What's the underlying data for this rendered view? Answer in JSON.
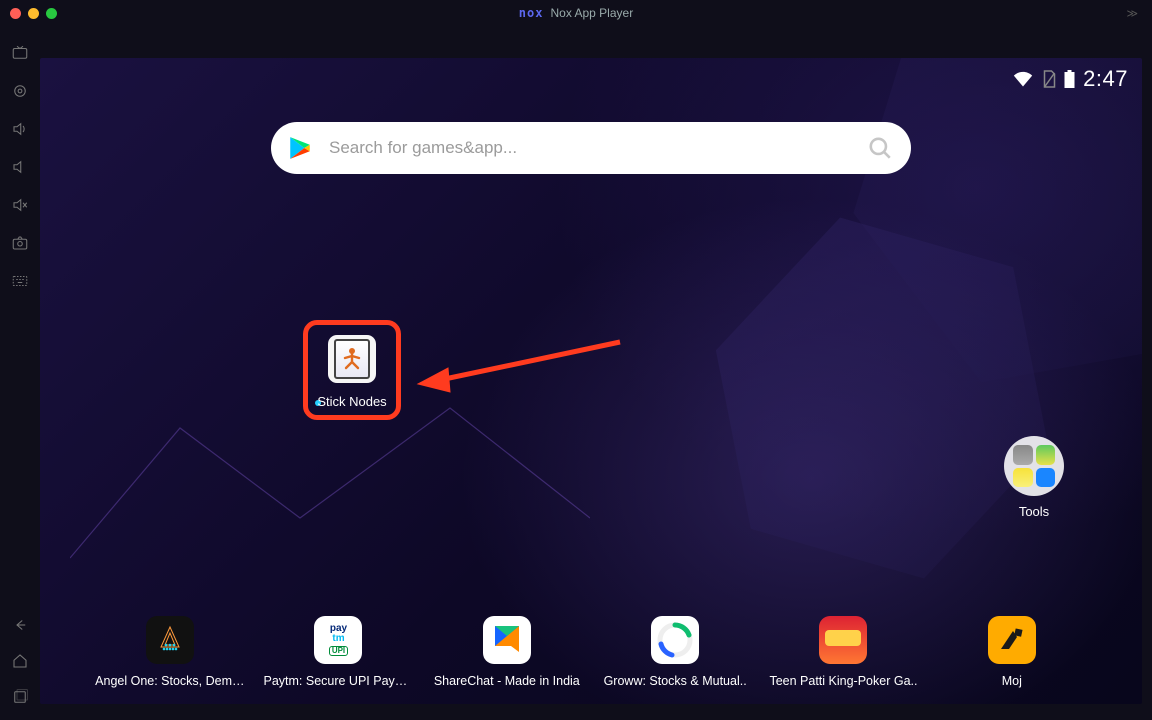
{
  "window": {
    "title": "Nox App Player",
    "brand": "nox"
  },
  "status": {
    "time": "2:47"
  },
  "search": {
    "placeholder": "Search for games&app..."
  },
  "highlight": {
    "label": "Stick Nodes"
  },
  "tools_folder": {
    "label": "Tools"
  },
  "dock": [
    {
      "label": "Angel One: Stocks, Demat.."
    },
    {
      "label": "Paytm: Secure UPI Payme.."
    },
    {
      "label": "ShareChat - Made in India"
    },
    {
      "label": "Groww: Stocks & Mutual.."
    },
    {
      "label": "Teen Patti King-Poker Ga.."
    },
    {
      "label": "Moj"
    }
  ]
}
